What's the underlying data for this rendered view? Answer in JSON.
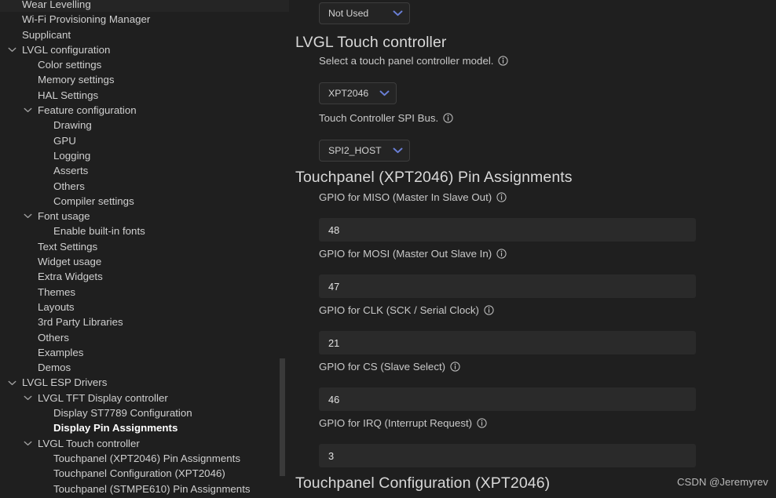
{
  "colors": {
    "background": "#1f1f1f",
    "sidebar_text": "#cfcfcf",
    "selected_text": "#ffffff",
    "heading_text": "#d8d8d8",
    "input_background": "#2a2a2a",
    "select_background": "#242424",
    "select_border": "#3d3d3d",
    "chevron_accent": "#6a7fd6",
    "scrollbar_thumb": "#3a3a3a"
  },
  "sidebar": {
    "items": [
      {
        "label": "Wear Levelling",
        "level": 1,
        "chevron": "none",
        "selected": false
      },
      {
        "label": "Wi-Fi Provisioning Manager",
        "level": 1,
        "chevron": "none",
        "selected": false
      },
      {
        "label": "Supplicant",
        "level": 1,
        "chevron": "none",
        "selected": false
      },
      {
        "label": "LVGL configuration",
        "level": 1,
        "chevron": "expanded",
        "selected": false
      },
      {
        "label": "Color settings",
        "level": 2,
        "chevron": "none",
        "selected": false
      },
      {
        "label": "Memory settings",
        "level": 2,
        "chevron": "none",
        "selected": false
      },
      {
        "label": "HAL Settings",
        "level": 2,
        "chevron": "none",
        "selected": false
      },
      {
        "label": "Feature configuration",
        "level": 2,
        "chevron": "expanded",
        "selected": false
      },
      {
        "label": "Drawing",
        "level": 3,
        "chevron": "none",
        "selected": false
      },
      {
        "label": "GPU",
        "level": 3,
        "chevron": "none",
        "selected": false
      },
      {
        "label": "Logging",
        "level": 3,
        "chevron": "none",
        "selected": false
      },
      {
        "label": "Asserts",
        "level": 3,
        "chevron": "none",
        "selected": false
      },
      {
        "label": "Others",
        "level": 3,
        "chevron": "none",
        "selected": false
      },
      {
        "label": "Compiler settings",
        "level": 3,
        "chevron": "none",
        "selected": false
      },
      {
        "label": "Font usage",
        "level": 2,
        "chevron": "expanded",
        "selected": false
      },
      {
        "label": "Enable built-in fonts",
        "level": 3,
        "chevron": "none",
        "selected": false
      },
      {
        "label": "Text Settings",
        "level": 2,
        "chevron": "none",
        "selected": false
      },
      {
        "label": "Widget usage",
        "level": 2,
        "chevron": "none",
        "selected": false
      },
      {
        "label": "Extra Widgets",
        "level": 2,
        "chevron": "none",
        "selected": false
      },
      {
        "label": "Themes",
        "level": 2,
        "chevron": "none",
        "selected": false
      },
      {
        "label": "Layouts",
        "level": 2,
        "chevron": "none",
        "selected": false
      },
      {
        "label": "3rd Party Libraries",
        "level": 2,
        "chevron": "none",
        "selected": false
      },
      {
        "label": "Others",
        "level": 2,
        "chevron": "none",
        "selected": false
      },
      {
        "label": "Examples",
        "level": 2,
        "chevron": "none",
        "selected": false
      },
      {
        "label": "Demos",
        "level": 2,
        "chevron": "none",
        "selected": false
      },
      {
        "label": "LVGL ESP Drivers",
        "level": 1,
        "chevron": "expanded",
        "selected": false
      },
      {
        "label": "LVGL TFT Display controller",
        "level": 2,
        "chevron": "expanded",
        "selected": false
      },
      {
        "label": "Display ST7789 Configuration",
        "level": 3,
        "chevron": "none",
        "selected": false
      },
      {
        "label": "Display Pin Assignments",
        "level": 3,
        "chevron": "none",
        "selected": true
      },
      {
        "label": "LVGL Touch controller",
        "level": 2,
        "chevron": "expanded",
        "selected": false
      },
      {
        "label": "Touchpanel (XPT2046) Pin Assignments",
        "level": 3,
        "chevron": "none",
        "selected": false
      },
      {
        "label": "Touchpanel Configuration (XPT2046)",
        "level": 3,
        "chevron": "none",
        "selected": false
      },
      {
        "label": "Touchpanel (STMPE610) Pin Assignments",
        "level": 3,
        "chevron": "none",
        "selected": false
      }
    ]
  },
  "main": {
    "top_select": {
      "value": "Not Used"
    },
    "touch_controller_section": {
      "heading": "LVGL Touch controller",
      "model_description": "Select a touch panel controller model.",
      "model_value": "XPT2046",
      "bus_description": "Touch Controller SPI Bus.",
      "bus_value": "SPI2_HOST"
    },
    "pin_assignments_section": {
      "heading": "Touchpanel (XPT2046) Pin Assignments",
      "fields": [
        {
          "label": "GPIO for MISO (Master In Slave Out)",
          "value": "48"
        },
        {
          "label": "GPIO for MOSI (Master Out Slave In)",
          "value": "47"
        },
        {
          "label": "GPIO for CLK (SCK / Serial Clock)",
          "value": "21"
        },
        {
          "label": "GPIO for CS (Slave Select)",
          "value": "46"
        },
        {
          "label": "GPIO for IRQ (Interrupt Request)",
          "value": "3"
        }
      ]
    },
    "configuration_section": {
      "heading": "Touchpanel Configuration (XPT2046)"
    }
  },
  "watermark": {
    "text": "CSDN @Jeremyrev"
  }
}
